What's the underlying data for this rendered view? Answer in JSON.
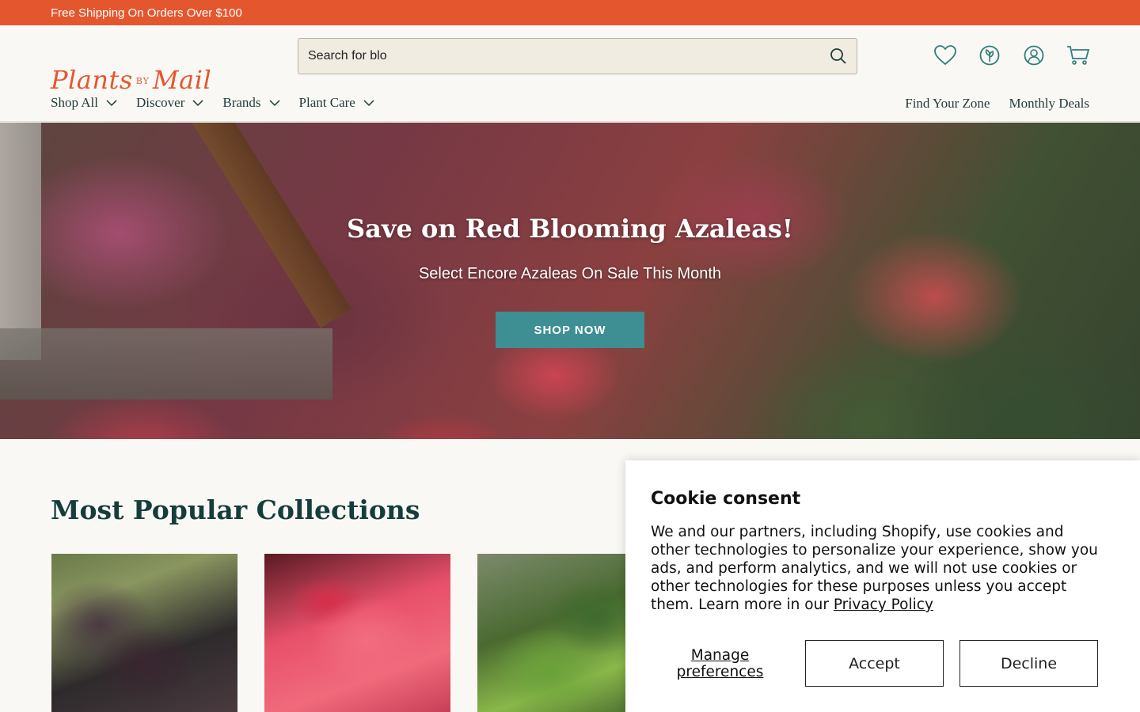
{
  "topbar": {
    "text": "Free Shipping On Orders Over $100"
  },
  "logo": {
    "word1": "Plants",
    "by": "BY",
    "word2": "Mail"
  },
  "search": {
    "value": "Search for blo",
    "placeholder": "Search"
  },
  "header_icons": [
    "heart-icon",
    "plant-zone-icon",
    "account-icon",
    "cart-icon"
  ],
  "nav": {
    "items": [
      {
        "label": "Shop All"
      },
      {
        "label": "Discover"
      },
      {
        "label": "Brands"
      },
      {
        "label": "Plant Care"
      }
    ],
    "right": [
      {
        "label": "Find Your Zone"
      },
      {
        "label": "Monthly Deals"
      }
    ]
  },
  "hero": {
    "title": "Save on Red Blooming Azaleas!",
    "subtitle": "Select Encore Azaleas On Sale This Month",
    "button": "SHOP NOW"
  },
  "collections": {
    "title": "Most Popular Collections"
  },
  "cookie": {
    "title": "Cookie consent",
    "text": "We and our partners, including Shopify, use cookies and other technologies to personalize your experience, show you ads, and perform analytics, and we will not use cookies or other technologies for these purposes unless you accept them. Learn more in our ",
    "link": "Privacy Policy",
    "manage": "Manage preferences",
    "accept": "Accept",
    "decline": "Decline"
  },
  "colors": {
    "accent": "#e4572e",
    "teal": "#3d8f94",
    "dark_green": "#163c3c"
  }
}
